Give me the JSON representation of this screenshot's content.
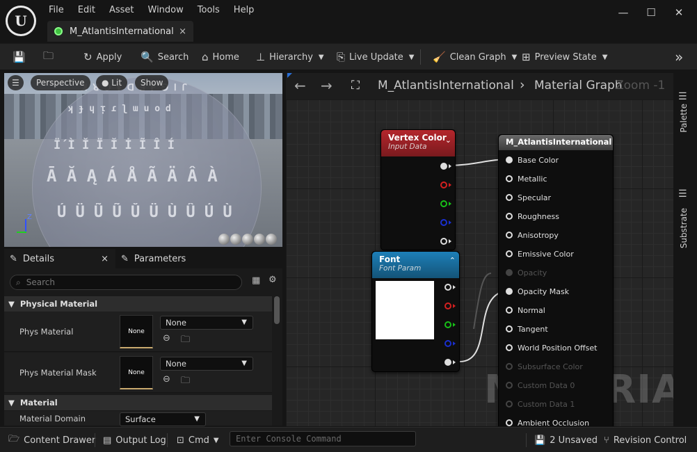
{
  "app": {
    "logo_text": "U"
  },
  "menu": [
    "File",
    "Edit",
    "Asset",
    "Window",
    "Tools",
    "Help"
  ],
  "document_tab": {
    "title": "M_AtlantisInternational",
    "close": "×"
  },
  "window_controls": {
    "minimize": "—",
    "maximize": "☐",
    "close": "✕"
  },
  "toolbar": {
    "apply": "Apply",
    "search": "Search",
    "home": "Home",
    "hierarchy": "Hierarchy",
    "live_update": "Live Update",
    "clean_graph": "Clean Graph",
    "preview_state": "Preview State",
    "overflow": "»"
  },
  "viewport": {
    "perspective": "Perspective",
    "lit": "Lit",
    "show": "Show",
    "axis_z": "Z",
    "glyph_rows": [
      "ꓘ ꓤ ꓛ ∀ ꓷ ꓱ ꓝ ꓨ ꓲ ꓩ",
      "ʞ ɟ ɥ ᴉ ɾ ʅ ɯ u o d",
      "Ḯ Ì Ǐ Ï Ĭ İ Ĩ Î Í",
      "Ā Ă Ą Á Å Ã Ä Â À",
      "Ú Ü Ũ Ũ Ǔ Ü Ù Û Ú Ù"
    ]
  },
  "details": {
    "tab_details": "Details",
    "tab_close": "×",
    "tab_parameters": "Parameters",
    "search_placeholder": "Search",
    "cat_physical": "Physical Material",
    "phys_material": {
      "label": "Phys Material",
      "thumb": "None",
      "value": "None"
    },
    "phys_material_mask": {
      "label": "Phys Material Mask",
      "thumb": "None",
      "value": "None"
    },
    "cat_material": "Material",
    "material_domain": {
      "label": "Material Domain",
      "value": "Surface"
    }
  },
  "graph": {
    "breadcrumb_asset": "M_AtlantisInternational",
    "breadcrumb_sep": "›",
    "breadcrumb_graph": "Material Graph",
    "zoom": "Zoom -1",
    "watermark": "MATERIAL",
    "vertex_color_node": {
      "title": "Vertex Color",
      "subtitle": "Input Data"
    },
    "font_node": {
      "title": "Font",
      "subtitle": "Font Param"
    },
    "material_node": {
      "title": "M_AtlantisInternational",
      "pins": [
        {
          "label": "Base Color",
          "active": true
        },
        {
          "label": "Metallic",
          "active": true
        },
        {
          "label": "Specular",
          "active": true
        },
        {
          "label": "Roughness",
          "active": true
        },
        {
          "label": "Anisotropy",
          "active": true
        },
        {
          "label": "Emissive Color",
          "active": true
        },
        {
          "label": "Opacity",
          "active": false
        },
        {
          "label": "Opacity Mask",
          "active": true
        },
        {
          "label": "Normal",
          "active": true
        },
        {
          "label": "Tangent",
          "active": true
        },
        {
          "label": "World Position Offset",
          "active": true
        },
        {
          "label": "Subsurface Color",
          "active": false
        },
        {
          "label": "Custom Data 0",
          "active": false
        },
        {
          "label": "Custom Data 1",
          "active": false
        },
        {
          "label": "Ambient Occlusion",
          "active": true
        }
      ]
    },
    "pin_colors": {
      "red": "#d42020",
      "green": "#18c018",
      "blue": "#1a2fd0",
      "white": "#e0e0e0"
    }
  },
  "side_tabs": {
    "palette": "Palette",
    "substrate": "Substrate"
  },
  "statusbar": {
    "content_drawer": "Content Drawer",
    "output_log": "Output Log",
    "cmd": "Cmd",
    "console_placeholder": "Enter Console Command",
    "unsaved": "2 Unsaved",
    "revision_control": "Revision Control"
  }
}
